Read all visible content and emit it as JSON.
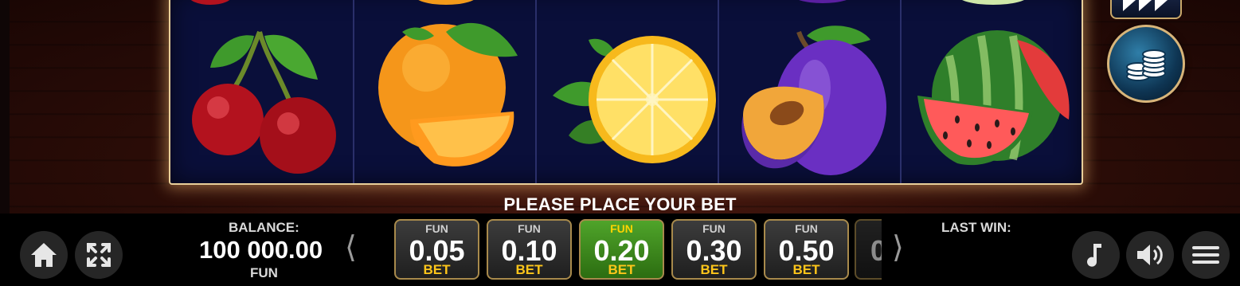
{
  "prompt": "PLEASE PLACE YOUR BET",
  "balance": {
    "label": "BALANCE:",
    "value": "100 000.00",
    "currency": "FUN"
  },
  "last_win": {
    "label": "LAST WIN:"
  },
  "bets": [
    {
      "currency": "FUN",
      "value": "0.05",
      "label": "BET",
      "selected": false
    },
    {
      "currency": "FUN",
      "value": "0.10",
      "label": "BET",
      "selected": false
    },
    {
      "currency": "FUN",
      "value": "0.20",
      "label": "BET",
      "selected": true
    },
    {
      "currency": "FUN",
      "value": "0.30",
      "label": "BET",
      "selected": false
    },
    {
      "currency": "FUN",
      "value": "0.50",
      "label": "BET",
      "selected": false
    },
    {
      "value": "0"
    }
  ],
  "arrows": {
    "left": "⟨",
    "right": "⟩"
  },
  "reels": [
    "cherry",
    "orange",
    "lemon",
    "plum",
    "watermelon"
  ],
  "icons": [
    "home-icon",
    "fullscreen-icon",
    "music-icon",
    "sound-icon",
    "menu-icon",
    "coins-icon",
    "turbo-icon"
  ],
  "colors": {
    "reel_bg": "#0a0f3a",
    "frame": "#e9cf9a",
    "selected_bet": "#3e8d1d",
    "bet_label": "#ffc61a"
  }
}
